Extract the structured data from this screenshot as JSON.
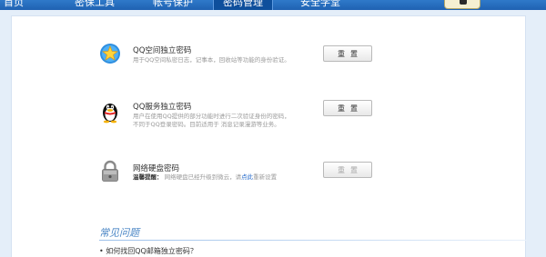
{
  "nav": {
    "items": [
      "首页",
      "密保工具",
      "帐号保护",
      "密码管理",
      "安全学堂"
    ],
    "active_index": 3
  },
  "rows": [
    {
      "title": "QQ空间独立密码",
      "desc_lines": [
        "用于QQ空间私密日志，记事本，回收站等功能的身份验证。"
      ],
      "button": "重置",
      "icon": "qzone-star-icon"
    },
    {
      "title": "QQ服务独立密码",
      "desc_lines": [
        "用户在使用QQ提供的部分功能时进行二次验证身份的密码，",
        "不同于QQ登录密码。目前适用于 消息记录漫游等业务。"
      ],
      "button": "重置",
      "icon": "qq-penguin-icon"
    },
    {
      "title": "网络硬盘密码",
      "tip_label": "温馨提醒：",
      "tip_text": "网络硬盘已经升级到微云，请",
      "tip_link": "点此",
      "tip_after": "重新设置",
      "button": "重置",
      "icon": "padlock-icon",
      "disabled": true
    }
  ],
  "faq": {
    "title": "常见问题",
    "items": [
      "• 如何找回QQ邮箱独立密码？"
    ]
  },
  "colors": {
    "nav_bg": "#2f79c9",
    "nav_active": "#0e4f9c",
    "page_bg": "#e4eef9",
    "faq_title": "#4a86c5",
    "link": "#1c64c8"
  }
}
